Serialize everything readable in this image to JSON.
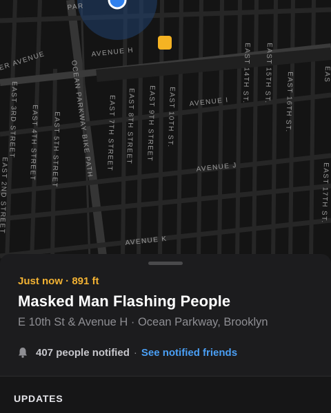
{
  "map": {
    "streets": {
      "avenue_h": "AVENUE H",
      "avenue_i": "AVENUE I",
      "avenue_j": "AVENUE J",
      "avenue_k": "AVENUE K",
      "er_avenue": "ER AVENUE",
      "ocean_parkway": "OCEAN PARKWAY BIKE PATH",
      "e3": "EAST 3RD STREET",
      "e2": "EAST 2ND STREET",
      "e4": "EAST 4TH STREET",
      "e5": "EAST 5TH STREET",
      "e7": "EAST 7TH STREET",
      "e8": "EAST 8TH STREET",
      "e9": "EAST 9TH STREET",
      "e10": "EAST 10TH ST.",
      "e14": "EAST 14TH ST.",
      "e15": "EAST 15TH ST.",
      "e16": "EAST 16TH ST.",
      "e17": "EAST 17TH ST.",
      "park_fragment": "PAR",
      "east_fragment": "EAS"
    },
    "colors": {
      "background": "#141414",
      "street": "#2a2a2a",
      "major_road": "#3a3a3a",
      "poi": "#f5b323",
      "location": "#2f80ed"
    }
  },
  "incident": {
    "meta": "Just now · 891 ft",
    "title": "Masked Man Flashing People",
    "subtitle": "E 10th St & Avenue H · Ocean Parkway, Brooklyn",
    "notified": "407 people notified",
    "separator": "·",
    "notified_link": "See notified friends",
    "bell_icon": "bell-icon"
  },
  "updates": {
    "label": "UPDATES"
  }
}
